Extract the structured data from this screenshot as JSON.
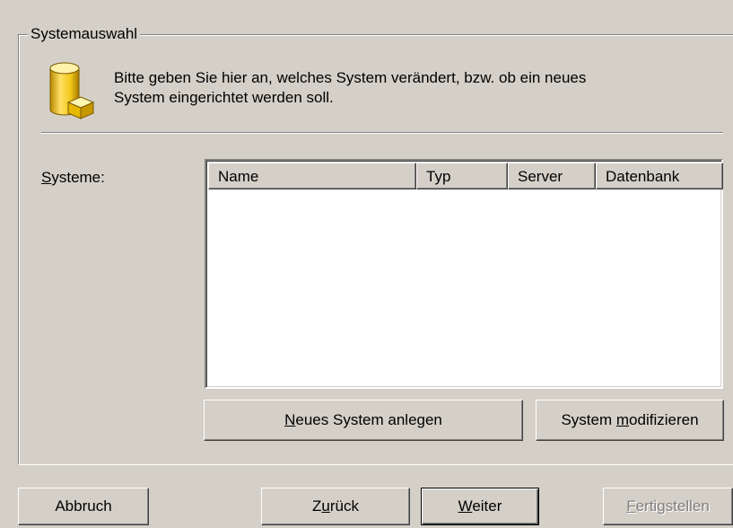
{
  "group": {
    "title": "Systemauswahl"
  },
  "description": {
    "line1": "Bitte geben Sie hier an, welches System verändert, bzw. ob ein neues",
    "line2": "System eingerichtet werden soll."
  },
  "systems_label": {
    "underlined": "S",
    "rest": "ysteme:"
  },
  "list": {
    "columns": [
      "Name",
      "Typ",
      "Server",
      "Datenbank"
    ],
    "rows": []
  },
  "actions": {
    "new_system": {
      "underlined": "N",
      "rest": "eues System anlegen"
    },
    "modify_system": {
      "before": "System ",
      "underlined": "m",
      "rest": "odifizieren"
    }
  },
  "wizard": {
    "cancel": "Abbruch",
    "back": {
      "before": "Z",
      "underlined": "u",
      "rest": "rück"
    },
    "next": {
      "underlined": "W",
      "rest": "eiter"
    },
    "finish": {
      "underlined": "F",
      "rest": "ertigstellen"
    }
  },
  "icon": "database-icon",
  "colors": {
    "face": "#d4d0c8",
    "shadow": "#808080",
    "highlight": "#ffffff",
    "disabled_text": "#808080",
    "icon_yellow": "#f2c81a"
  }
}
